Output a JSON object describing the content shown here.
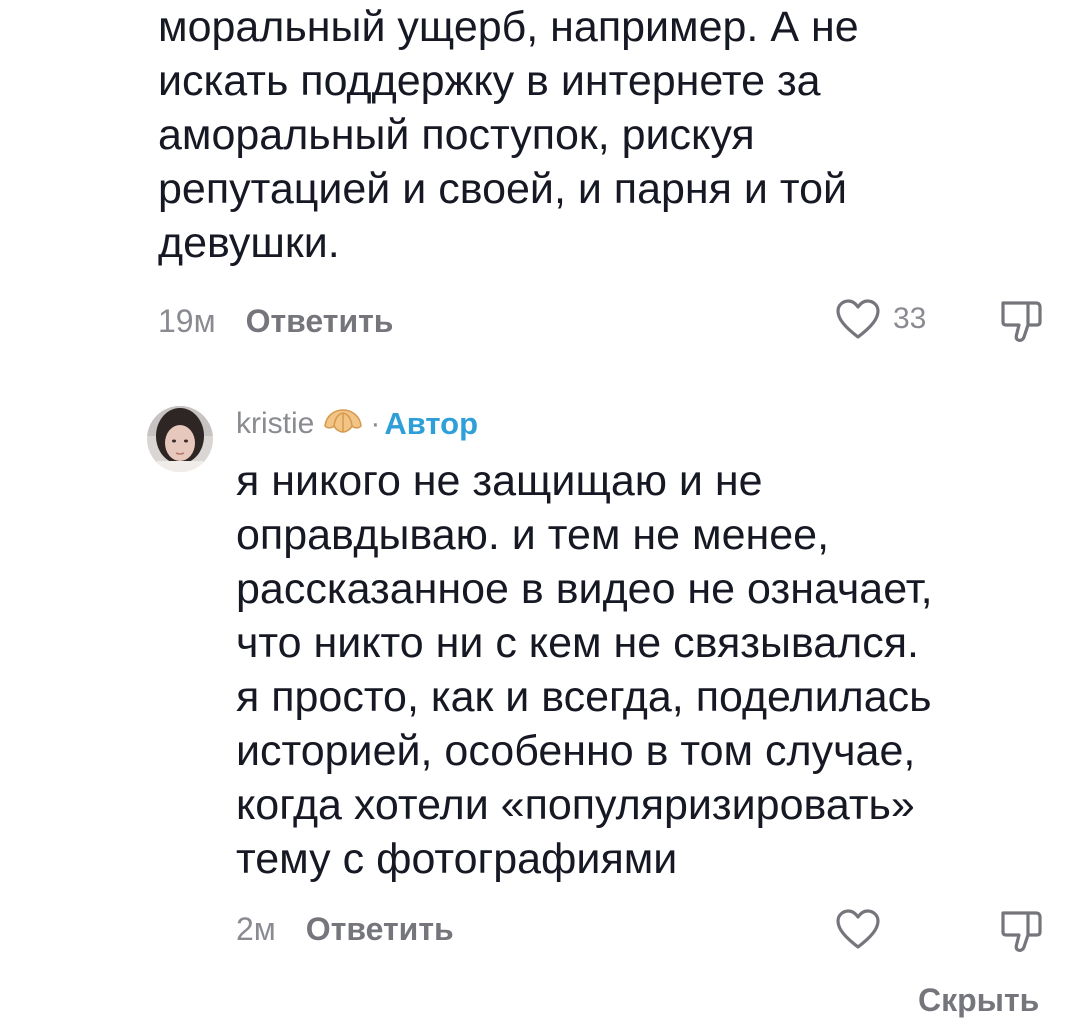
{
  "comments": [
    {
      "text": "моральный ущерб, например. А не\nискать поддержку в интернете за\nаморальный поступок, рискуя\nрепутацией и своей, и парня и той\nдевушки.",
      "time": "19м",
      "reply_label": "Ответить",
      "likes": "33",
      "like_icon": "heart-outline",
      "dislike_icon": "thumbs-down-outline"
    },
    {
      "username": "kristie",
      "badge_emoji": "croissant",
      "separator": "·",
      "author_label": "Автор",
      "text": "я никого не защищаю и не\nоправдываю. и тем не менее,\nрассказанное в видео не означает,\nчто никто ни с кем не связывался.\nя просто, как и всегда, поделилась\nисторией, особенно в том случае,\nкогда хотели «популяризировать»\nтему с фотографиями",
      "time": "2м",
      "reply_label": "Ответить",
      "likes": "",
      "like_icon": "heart-outline",
      "dislike_icon": "thumbs-down-outline"
    }
  ],
  "footer": {
    "hide_label": "Скрыть"
  },
  "colors": {
    "text": "#161823",
    "muted": "#8a8b91",
    "author_accent": "#2e9fd8"
  }
}
